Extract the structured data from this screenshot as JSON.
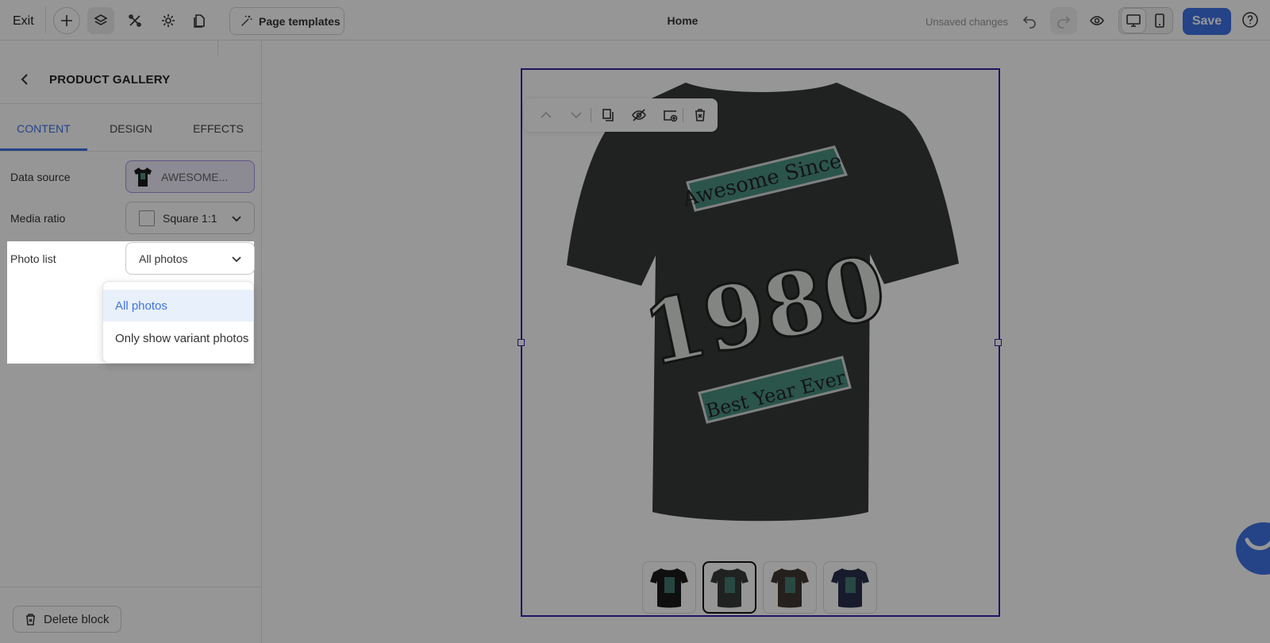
{
  "topbar": {
    "exit_label": "Exit",
    "page_templates_label": "Page templates",
    "page_title": "Home",
    "unsaved_label": "Unsaved changes",
    "save_label": "Save"
  },
  "panel": {
    "title": "PRODUCT GALLERY",
    "tabs": [
      {
        "label": "CONTENT",
        "active": true
      },
      {
        "label": "DESIGN",
        "active": false
      },
      {
        "label": "EFFECTS",
        "active": false
      }
    ],
    "data_source": {
      "label": "Data source",
      "value": "AWESOME..."
    },
    "media_ratio": {
      "label": "Media ratio",
      "value": "Square 1:1"
    },
    "photo_list": {
      "label": "Photo list",
      "value": "All photos",
      "options": [
        "All photos",
        "Only show variant photos"
      ],
      "selected_index": 0
    },
    "delete_label": "Delete block"
  },
  "gallery": {
    "thumbnails": [
      {
        "color": "#1b1b1b",
        "selected": false
      },
      {
        "color": "#363b38",
        "selected": true
      },
      {
        "color": "#3e3733",
        "selected": false
      },
      {
        "color": "#2a2e49",
        "selected": false
      }
    ]
  },
  "colors": {
    "accent": "#3f73e6",
    "selection": "#3b1fa3",
    "shirt": "#363b38",
    "print_teal": "#4a8f80"
  }
}
